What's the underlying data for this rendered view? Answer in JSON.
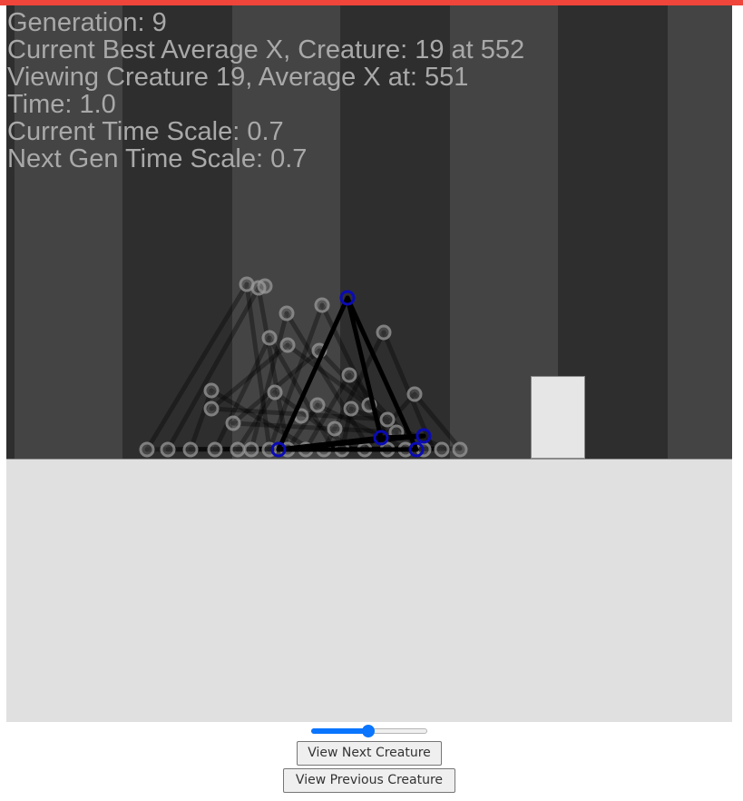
{
  "hud": {
    "generation": "Generation: 9",
    "best": "Current Best Average X, Creature: 19 at 552",
    "viewing": "Viewing Creature 19, Average X at: 551",
    "time": "Time: 1.0",
    "time_scale": "Current Time Scale: 0.7",
    "next_time_scale": "Next Gen Time Scale: 0.7"
  },
  "controls": {
    "time_scale_slider_value": 0.49,
    "next_button_label": "View Next Creature",
    "prev_button_label": "View Previous Creature"
  },
  "colors": {
    "top_bar": "#f0453a",
    "background_dark": "#2e2e2e",
    "stripe_light": "#444444",
    "ground": "#e0e0e0",
    "creature_node": "#0a0ab4",
    "creature_muscle": "#000000",
    "ghost_node": "#9a9a9a",
    "slider_accent": "#0a75ff"
  },
  "icons": {
    "creature_node": "circle-node-icon",
    "ghost_node": "ghost-circle-node-icon"
  }
}
